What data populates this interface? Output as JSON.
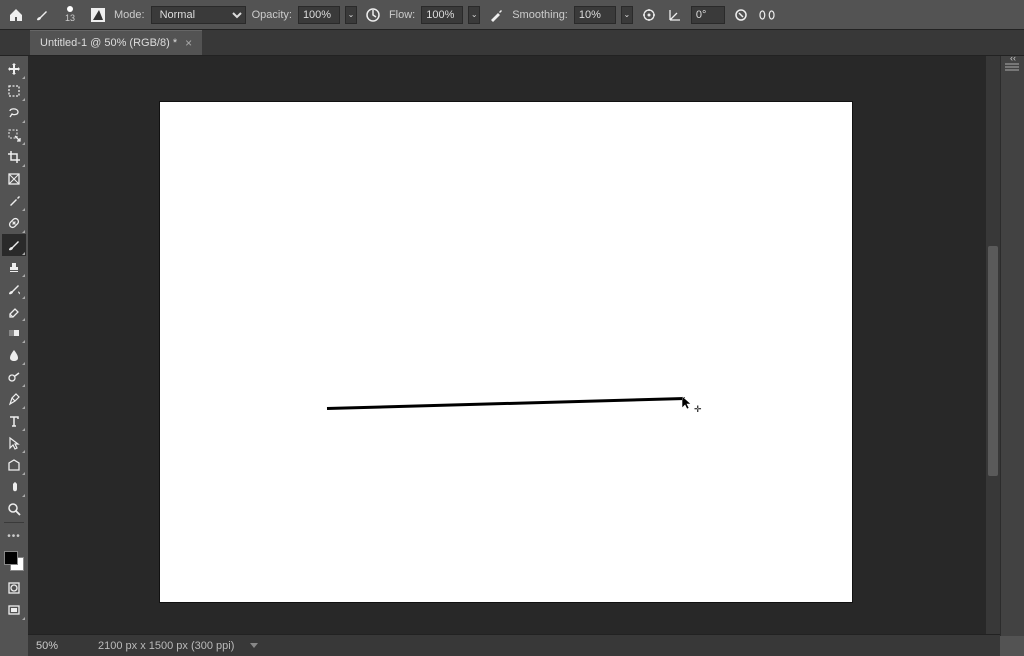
{
  "options": {
    "brush_size": "13",
    "mode_label": "Mode:",
    "mode_value": "Normal",
    "opacity_label": "Opacity:",
    "opacity_value": "100%",
    "flow_label": "Flow:",
    "flow_value": "100%",
    "smoothing_label": "Smoothing:",
    "smoothing_value": "10%",
    "angle_value": "0°"
  },
  "tab": {
    "title": "Untitled-1 @ 50% (RGB/8) *"
  },
  "status": {
    "zoom": "50%",
    "doc_info": "2100 px x 1500 px (300 ppi)"
  },
  "colors": {
    "fg": "#000000",
    "bg": "#ffffff"
  }
}
